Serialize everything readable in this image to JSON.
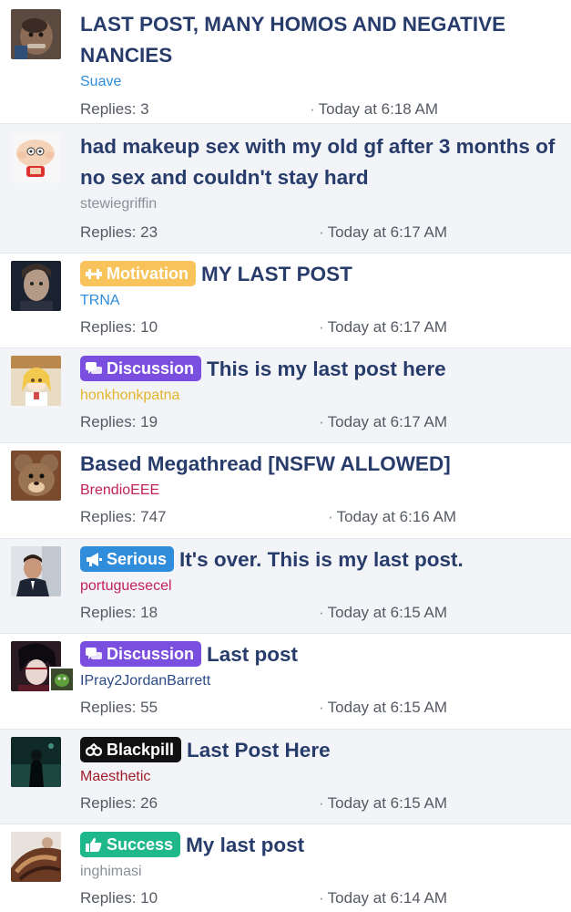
{
  "meta_labels": {
    "replies_prefix": "Replies:"
  },
  "colors": {
    "title": "#273c6b",
    "row_alt_background": "#f3f4f7",
    "prefix_motivation": "#f7c35a",
    "prefix_discussion": "#7a4fe0",
    "prefix_serious": "#2f8ddc",
    "prefix_blackpill": "#111111",
    "prefix_success": "#1fb88a"
  },
  "threads": [
    {
      "title": "LAST POST, MANY HOMOS AND NEGATIVE NANCIES",
      "prefix": null,
      "prefix_icon": null,
      "user": "Suave",
      "user_color": "#2f8ddc",
      "replies": "Replies: 3",
      "time": "Today at 6:18 AM"
    },
    {
      "title": "had makeup sex with my old gf after 3 months of no sex and couldn't stay hard",
      "prefix": null,
      "prefix_icon": null,
      "user": "stewiegriffin",
      "user_color": "#8a8f98",
      "replies": "Replies: 23",
      "time": "Today at 6:17 AM"
    },
    {
      "title": "MY LAST POST",
      "prefix": "Motivation",
      "prefix_icon": "dumbbell-icon",
      "user": "TRNA",
      "user_color": "#2f8ddc",
      "replies": "Replies: 10",
      "time": "Today at 6:17 AM"
    },
    {
      "title": "This is my last post here",
      "prefix": "Discussion",
      "prefix_icon": "chat-bubbles-icon",
      "user": "honkhonkpatna",
      "user_color": "#e3b52b",
      "replies": "Replies: 19",
      "time": "Today at 6:17 AM"
    },
    {
      "title": "Based Megathread [NSFW ALLOWED]",
      "prefix": null,
      "prefix_icon": null,
      "user": "BrendioEEE",
      "user_color": "#c3205a",
      "replies": "Replies: 747",
      "time": "Today at 6:16 AM"
    },
    {
      "title": "It's over. This is my last post.",
      "prefix": "Serious",
      "prefix_icon": "megaphone-icon",
      "user": "portuguesecel",
      "user_color": "#c3205a",
      "replies": "Replies: 18",
      "time": "Today at 6:15 AM"
    },
    {
      "title": "Last post",
      "prefix": "Discussion",
      "prefix_icon": "chat-bubbles-icon",
      "user": "IPray2JordanBarrett",
      "user_color": "#2b4a86",
      "replies": "Replies: 55",
      "time": "Today at 6:15 AM"
    },
    {
      "title": "Last Post Here",
      "prefix": "Blackpill",
      "prefix_icon": "pill-icon",
      "user": "Maesthetic",
      "user_color": "#a01c2a",
      "replies": "Replies: 26",
      "time": "Today at 6:15 AM"
    },
    {
      "title": "My last post",
      "prefix": "Success",
      "prefix_icon": "thumbs-up-icon",
      "user": "inghimasi",
      "user_color": "#8a8f98",
      "replies": "Replies: 10",
      "time": "Today at 6:14 AM"
    }
  ]
}
